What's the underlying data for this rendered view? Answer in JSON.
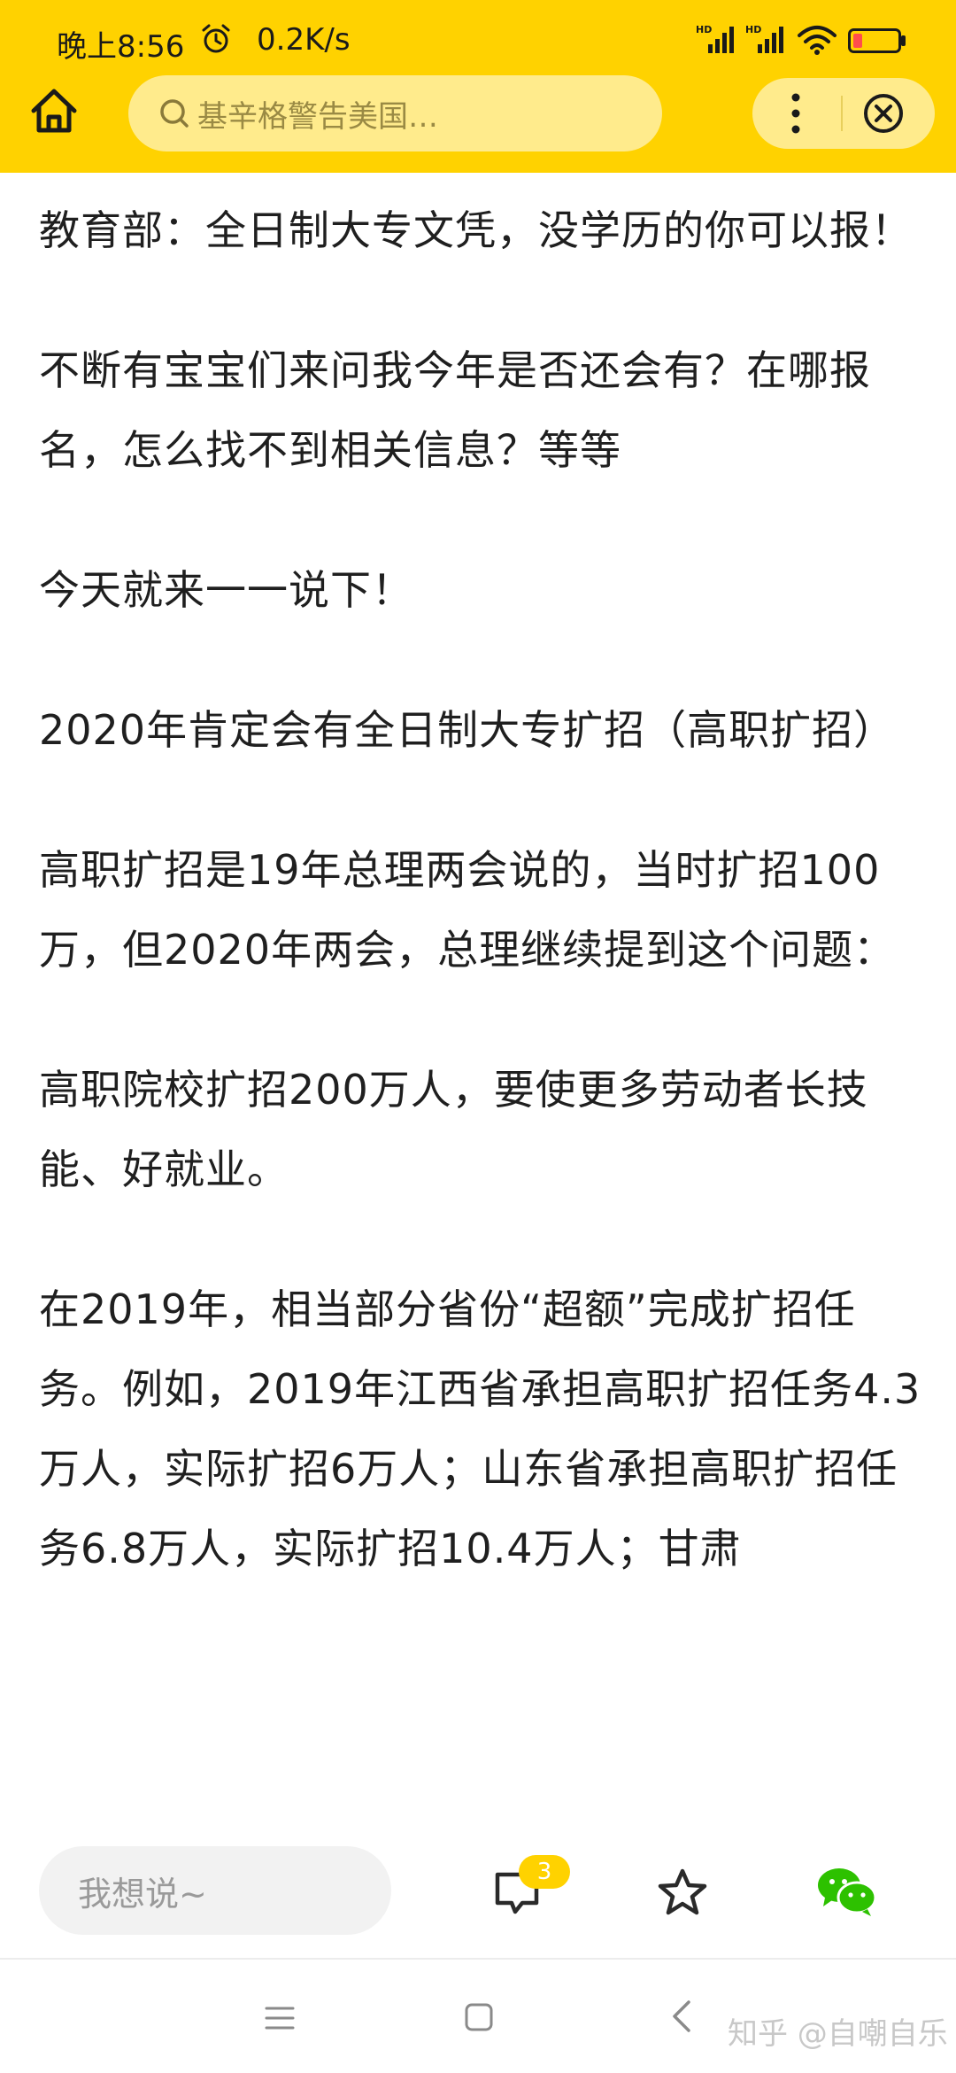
{
  "status_bar": {
    "time": "晚上8:56",
    "net_speed": "0.2K/s",
    "icons": [
      "alarm-clock-icon",
      "hd-signal-icon",
      "hd-signal-icon",
      "wifi-icon",
      "battery-icon"
    ]
  },
  "header": {
    "search_text": "基辛格警告美国…",
    "icons": [
      "home-icon",
      "search-icon",
      "more-vertical-icon",
      "close-circle-icon"
    ],
    "accent_color": "#ffd200"
  },
  "article": {
    "paragraphs": [
      "教育部：全日制大专文凭，没学历的你可以报！",
      "不断有宝宝们来问我今年是否还会有？在哪报名，怎么找不到相关信息？等等",
      "今天就来一一说下！",
      "2020年肯定会有全日制大专扩招（高职扩招）",
      "高职扩招是19年总理两会说的，当时扩招100万，但2020年两会，总理继续提到这个问题：",
      "高职院校扩招200万人，要使更多劳动者长技能、好就业。",
      "在2019年，相当部分省份“超额”完成扩招任务。例如，2019年江西省承担高职扩招任务4.3万人，实际扩招6万人；山东省承担高职扩招任务6.8万人，实际扩招10.4万人；甘肃"
    ]
  },
  "bottom_bar": {
    "comment_placeholder": "我想说~",
    "comment_count": "3",
    "icons": [
      "comment-icon",
      "star-icon",
      "wechat-icon"
    ],
    "wechat_color": "#2dc100"
  },
  "nav_bar": {
    "icons": [
      "menu-icon",
      "home-square-icon",
      "back-icon"
    ],
    "watermark": "知乎 @自嘲自乐"
  }
}
